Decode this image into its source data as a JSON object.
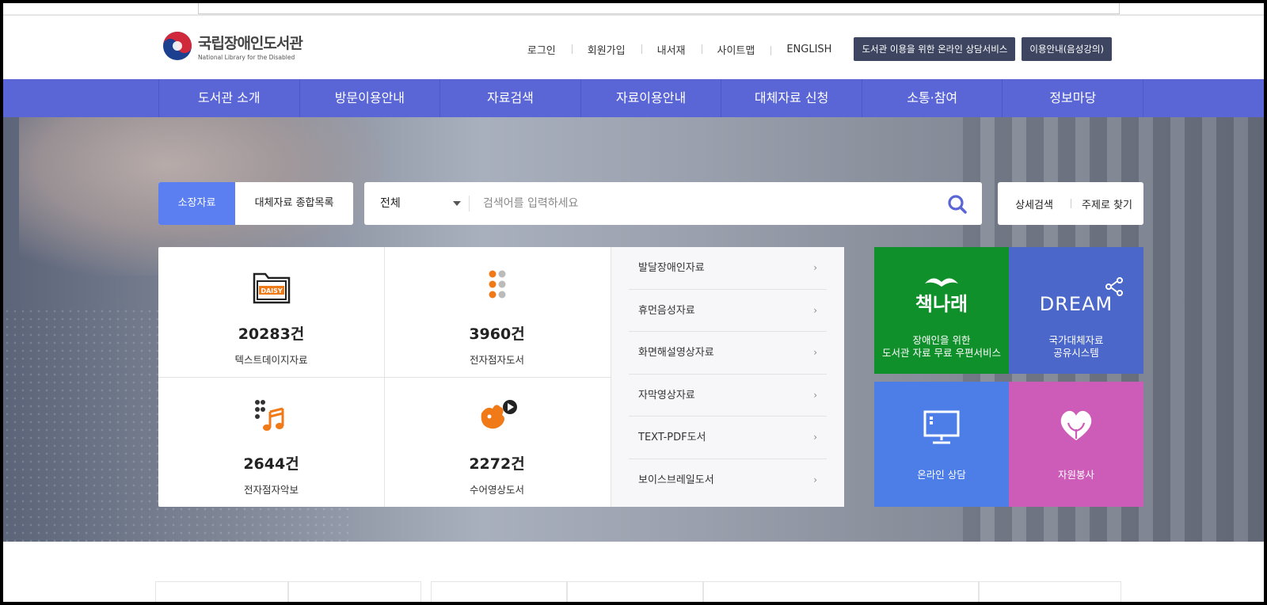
{
  "header": {
    "logo_kr": "국립장애인도서관",
    "logo_en": "National Library for the Disabled",
    "util_links": [
      "로그인",
      "회원가입",
      "내서재",
      "사이트맵",
      "ENGLISH"
    ],
    "btn_counsel": "도서관 이용을 위한 온라인 상담서비스",
    "btn_guide": "이용안내(음성강의)"
  },
  "gnb": [
    "도서관 소개",
    "방문이용안내",
    "자료검색",
    "자료이용안내",
    "대체자료 신청",
    "소통·참여",
    "정보마당"
  ],
  "search": {
    "tab_active": "소장자료",
    "tab_other": "대체자료 종합목록",
    "scope": "전체",
    "placeholder": "검색어를 입력하세요",
    "advanced": "상세검색",
    "subject": "주제로 찾기"
  },
  "stats": [
    {
      "count": "20283건",
      "label": "텍스트데이지자료",
      "icon": "daisy-folder-icon"
    },
    {
      "count": "3960건",
      "label": "전자점자도서",
      "icon": "braille-dots-icon"
    },
    {
      "count": "2644건",
      "label": "전자점자악보",
      "icon": "braille-music-icon"
    },
    {
      "count": "2272건",
      "label": "수어영상도서",
      "icon": "sign-language-video-icon"
    }
  ],
  "material_links": [
    "발달장애인자료",
    "휴먼음성자료",
    "화면해설영상자료",
    "자막영상자료",
    "TEXT-PDF도서",
    "보이스브레일도서"
  ],
  "tiles": {
    "green_logo": "책나래",
    "green_text_1": "장애인을 위한",
    "green_text_2": "도서관 자료 무료 우편서비스",
    "blue_logo": "DREAM",
    "blue_text_1": "국가대체자료",
    "blue_text_2": "공유시스템",
    "sky_text": "온라인 상담",
    "pink_text": "자원봉사"
  },
  "colors": {
    "gnb": "#5b66d6",
    "tab_active": "#5b7ef0",
    "tile_green": "#10902b",
    "tile_blue": "#4a67c9",
    "tile_sky": "#4d7ee8",
    "tile_pink": "#cd5bb8",
    "icon_orange": "#f07a18"
  }
}
